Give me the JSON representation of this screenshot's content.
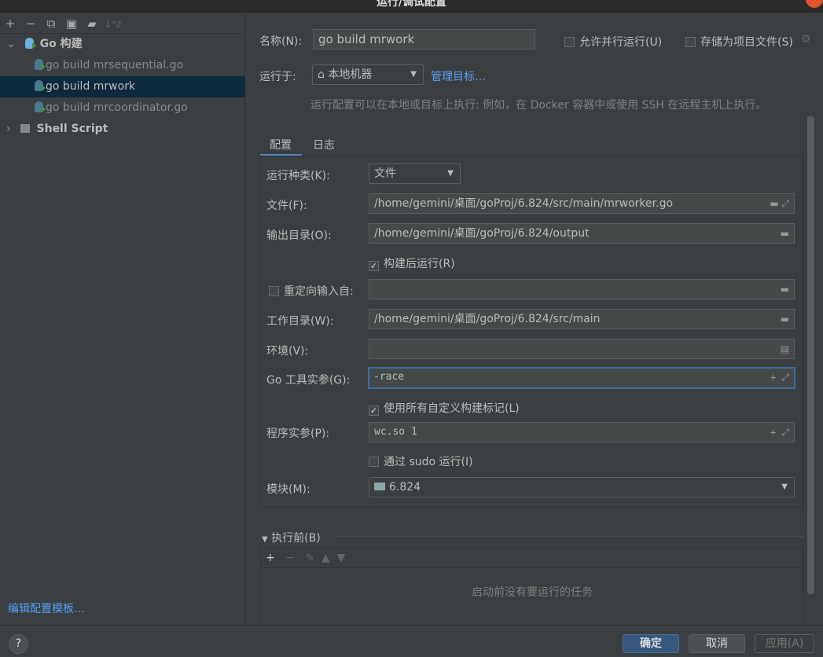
{
  "window": {
    "title": "运行/调试配置"
  },
  "sidebar": {
    "toolbar": [
      "+",
      "−",
      "⧉",
      "💾",
      "📁",
      "↓ᵃz"
    ],
    "tree": [
      {
        "label": "Go 构建",
        "type": "group",
        "expanded": true
      },
      {
        "label": "go build mrsequential.go",
        "type": "item"
      },
      {
        "label": "go build mrwork",
        "type": "item",
        "selected": true
      },
      {
        "label": "go build mrcoordinator.go",
        "type": "item"
      },
      {
        "label": "Shell Script",
        "type": "group",
        "expanded": false
      }
    ],
    "edit_templates": "编辑配置模板…"
  },
  "header": {
    "name_label": "名称(N):",
    "name_value": "go build mrwork",
    "allow_parallel": "允许并行运行(U)",
    "allow_parallel_checked": false,
    "store_as_file": "存储为项目文件(S)",
    "store_as_file_checked": false,
    "run_on_label": "运行于:",
    "run_on_value": "本地机器",
    "manage_targets": "管理目标…",
    "description": "运行配置可以在本地或目标上执行: 例如，在 Docker 容器中或使用 SSH 在远程主机上执行。"
  },
  "tabs": [
    {
      "label": "配置",
      "active": true
    },
    {
      "label": "日志",
      "active": false
    }
  ],
  "form": {
    "run_kind_label": "运行种类(K):",
    "run_kind_value": "文件",
    "file_label": "文件(F):",
    "file_value": "/home/gemini/桌面/goProj/6.824/src/main/mrworker.go",
    "output_label": "输出目录(O):",
    "output_value": "/home/gemini/桌面/goProj/6.824/output",
    "run_after_build": "构建后运行(R)",
    "run_after_build_checked": true,
    "redirect_label": "重定向输入自:",
    "redirect_checked": false,
    "redirect_value": "",
    "workdir_label": "工作目录(W):",
    "workdir_value": "/home/gemini/桌面/goProj/6.824/src/main",
    "env_label": "环境(V):",
    "env_value": "",
    "go_tool_args_label": "Go 工具实参(G):",
    "go_tool_args_value": "-race",
    "use_all_tags": "使用所有自定义构建标记(L)",
    "use_all_tags_checked": true,
    "program_args_label": "程序实参(P):",
    "program_args_value": "wc.so 1",
    "sudo": "通过 sudo 运行(I)",
    "sudo_checked": false,
    "module_label": "模块(M):",
    "module_value": "6.824"
  },
  "before_launch": {
    "title": "执行前(B)",
    "empty_text": "启动前没有要运行的任务"
  },
  "footer": {
    "ok": "确定",
    "cancel": "取消",
    "apply": "应用(A)",
    "help": "?"
  },
  "colors": {
    "accent": "#589df6",
    "selected_row": "#0d293e",
    "primary_button": "#365880"
  }
}
